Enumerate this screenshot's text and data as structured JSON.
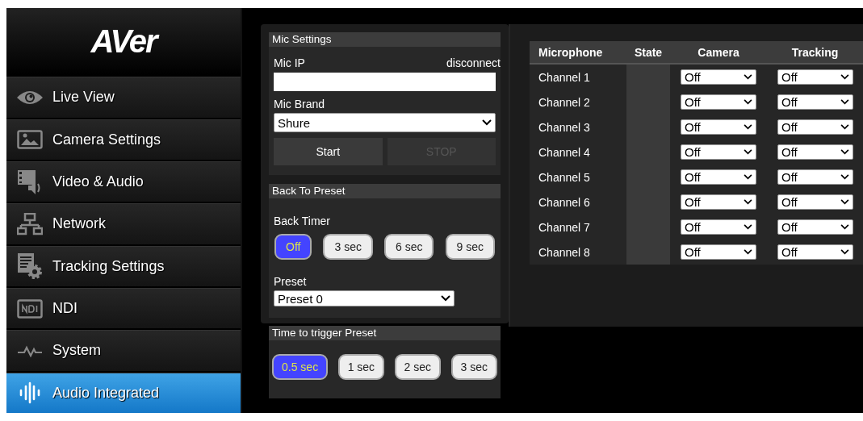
{
  "sidebar": {
    "logo": "AVer",
    "items": [
      {
        "label": "Live View",
        "selected": false
      },
      {
        "label": "Camera Settings",
        "selected": false
      },
      {
        "label": "Video & Audio",
        "selected": false
      },
      {
        "label": "Network",
        "selected": false
      },
      {
        "label": "Tracking Settings",
        "selected": false
      },
      {
        "label": "NDI",
        "selected": false
      },
      {
        "label": "System",
        "selected": false
      },
      {
        "label": "Audio Integrated",
        "selected": true
      }
    ]
  },
  "mic_settings": {
    "title": "Mic Settings",
    "mic_ip_label": "Mic IP",
    "status": "disconnect",
    "mic_brand_label": "Mic Brand",
    "mic_brand": "Shure",
    "buttons": [
      {
        "label": "Start",
        "disabled": false
      },
      {
        "label": "STOP",
        "disabled": true
      }
    ]
  },
  "back_to_preset": {
    "title": "Back To Preset",
    "timer_label": "Back Timer",
    "options": [
      {
        "label": "Off",
        "selected": true
      },
      {
        "label": "3 sec",
        "selected": false
      },
      {
        "label": "6 sec",
        "selected": false
      },
      {
        "label": "9 sec",
        "selected": false
      }
    ],
    "preset_label": "Preset",
    "preset": "Preset 0"
  },
  "time_to_trigger": {
    "title": "Time to trigger Preset",
    "options": [
      {
        "label": "0.5 sec",
        "selected": true
      },
      {
        "label": "1 sec",
        "selected": false
      },
      {
        "label": "2 sec",
        "selected": false
      },
      {
        "label": "3 sec",
        "selected": false
      }
    ]
  },
  "table": {
    "columns": [
      "Microphone",
      "State",
      "Camera",
      "Tracking"
    ],
    "rows": [
      {
        "name": "Channel 1",
        "camera": "Off",
        "tracking": "Off"
      },
      {
        "name": "Channel 2",
        "camera": "Off",
        "tracking": "Off"
      },
      {
        "name": "Channel 3",
        "camera": "Off",
        "tracking": "Off"
      },
      {
        "name": "Channel 4",
        "camera": "Off",
        "tracking": "Off"
      },
      {
        "name": "Channel 5",
        "camera": "Off",
        "tracking": "Off"
      },
      {
        "name": "Channel 6",
        "camera": "Off",
        "tracking": "Off"
      },
      {
        "name": "Channel 7",
        "camera": "Off",
        "tracking": "Off"
      },
      {
        "name": "Channel 8",
        "camera": "Off",
        "tracking": "Off"
      }
    ]
  }
}
